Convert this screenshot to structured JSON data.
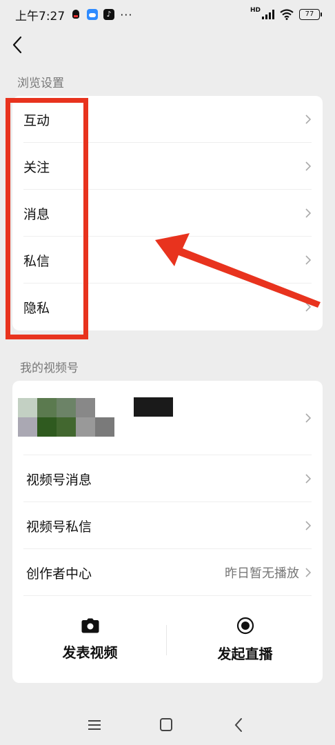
{
  "status_bar": {
    "time": "上午7:27",
    "icons": [
      "qq-icon",
      "cloud-icon",
      "tiktok-icon"
    ],
    "more": "···",
    "network_label": "HD",
    "battery": "77"
  },
  "section_browse": {
    "title": "浏览设置",
    "items": [
      {
        "label": "互动",
        "icon": "chevron-right-icon"
      },
      {
        "label": "关注",
        "icon": "chevron-right-icon"
      },
      {
        "label": "消息",
        "icon": "chevron-right-icon"
      },
      {
        "label": "私信",
        "icon": "chevron-right-icon"
      },
      {
        "label": "隐私",
        "icon": "chevron-right-icon"
      }
    ]
  },
  "section_channels": {
    "title": "我的视频号",
    "items": [
      {
        "label": "视频号消息",
        "value": ""
      },
      {
        "label": "视频号私信",
        "value": ""
      },
      {
        "label": "创作者中心",
        "value": "昨日暂无播放"
      }
    ],
    "actions": [
      {
        "label": "发表视频",
        "icon": "camera-icon"
      },
      {
        "label": "发起直播",
        "icon": "live-record-icon"
      }
    ]
  },
  "annotation": {
    "box_color": "#e8331e",
    "arrow_color": "#e8331e"
  },
  "nav": {
    "icons": [
      "menu-icon",
      "home-icon",
      "back-icon"
    ]
  }
}
